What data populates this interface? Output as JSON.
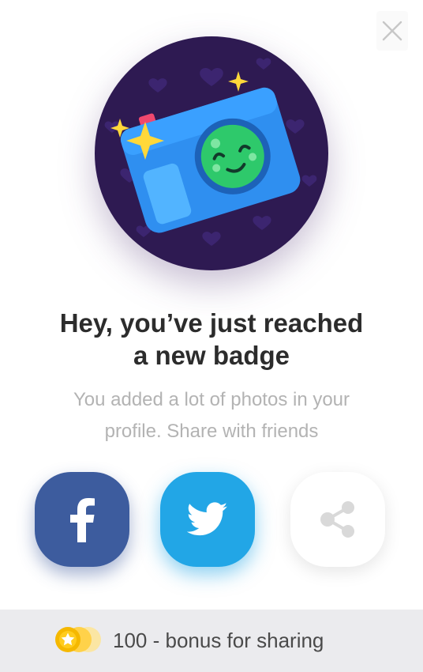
{
  "dialog": {
    "close_icon": "close-icon",
    "badge_icon": "camera-badge-icon"
  },
  "headline": {
    "line1": "Hey, you’ve just reached",
    "line2": "a new badge"
  },
  "subtitle": {
    "line1": "You added a lot of photos in your",
    "line2": "profile. Share with friends"
  },
  "share": {
    "buttons": [
      {
        "network": "facebook",
        "icon": "facebook-icon",
        "color": "#3d5c9e"
      },
      {
        "network": "twitter",
        "icon": "twitter-icon",
        "color": "#22a6e6"
      },
      {
        "network": "share",
        "icon": "share-icon",
        "color": "#ffffff"
      }
    ]
  },
  "footer": {
    "coin_icon": "coin-star-icon",
    "bonus_text": "100 - bonus for sharing"
  },
  "colors": {
    "badge_background": "#2e1a52",
    "camera_body": "#2f8ff0",
    "lens_green": "#2ec96b",
    "sparkle": "#ffd83a",
    "footer_bg": "#ebebee"
  }
}
